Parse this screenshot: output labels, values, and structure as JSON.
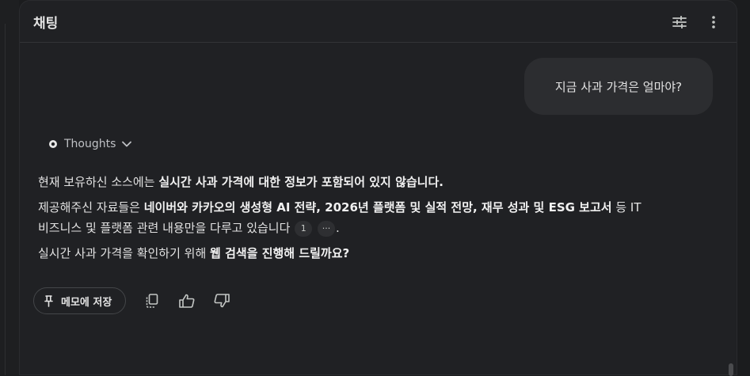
{
  "header": {
    "title": "채팅"
  },
  "conversation": {
    "user_message": "지금 사과 가격은 얼마야?",
    "thoughts_label": "Thoughts",
    "answer": {
      "p1_normal": "현재 보유하신 소스에는 ",
      "p1_bold": "실시간 사과 가격에 대한 정보가 포함되어 있지 않습니다.",
      "p2_normal_a": "제공해주신 자료들은 ",
      "p2_bold_a": "네이버와 카카오의 생성형 AI 전략, 2026년 플랫폼 및 실적 전망, 재무 성과 및 ESG 보고서",
      "p2_normal_b": " 등 IT 비즈니스 및 플랫폼 관련 내용만을 다루고 있습니다",
      "citation_1": "1",
      "citation_more": "···",
      "p2_end": ".",
      "p3_normal": "실시간 사과 가격을 확인하기 위해 ",
      "p3_bold": "웹 검색을 진행해 드릴까요?"
    }
  },
  "actions": {
    "save_memo_label": "메모에 저장"
  }
}
